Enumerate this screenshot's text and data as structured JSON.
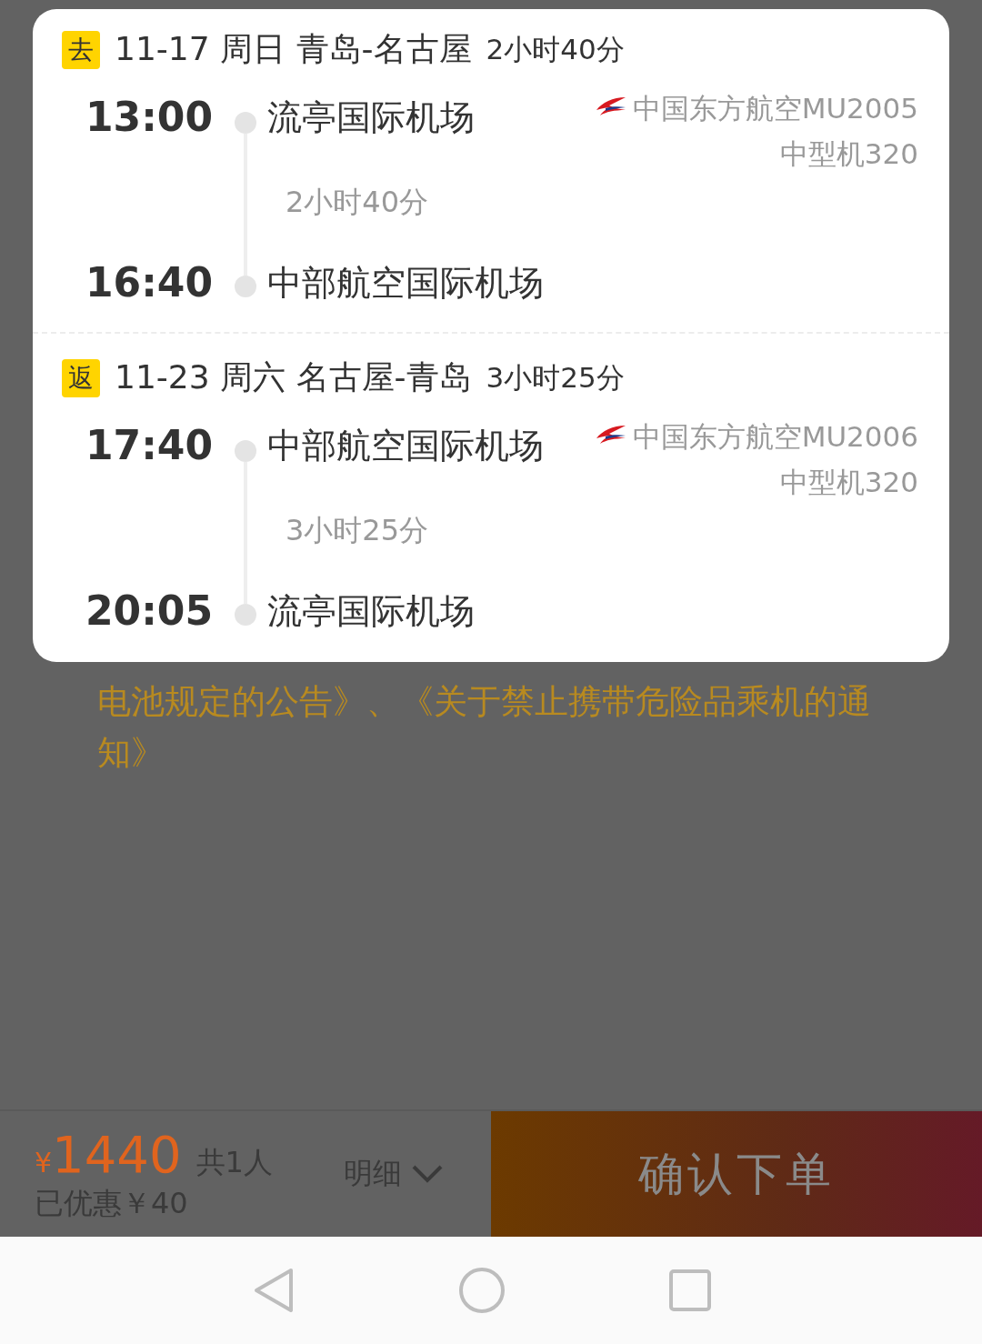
{
  "segments": [
    {
      "tag": "去",
      "date": "11-17",
      "weekday": "周日",
      "route": "青岛-名古屋",
      "total": "2小时40分",
      "departure": {
        "time": "13:00",
        "airport": "流亭国际机场"
      },
      "duration": "2小时40分",
      "arrival": {
        "time": "16:40",
        "airport": "中部航空国际机场"
      },
      "airline": "中国东方航空MU2005",
      "aircraft": "中型机320"
    },
    {
      "tag": "返",
      "date": "11-23",
      "weekday": "周六",
      "route": "名古屋-青岛",
      "total": "3小时25分",
      "departure": {
        "time": "17:40",
        "airport": "中部航空国际机场"
      },
      "duration": "3小时25分",
      "arrival": {
        "time": "20:05",
        "airport": "流亭国际机场"
      },
      "airline": "中国东方航空MU2006",
      "aircraft": "中型机320"
    }
  ],
  "notice": "电池规定的公告》、《关于禁止携带危险品乘机的通知》",
  "footer": {
    "currency": "¥",
    "price": "1440",
    "travelers": "共1人",
    "discount": "已优惠￥40",
    "details": "明细",
    "submit": "确认下单"
  }
}
